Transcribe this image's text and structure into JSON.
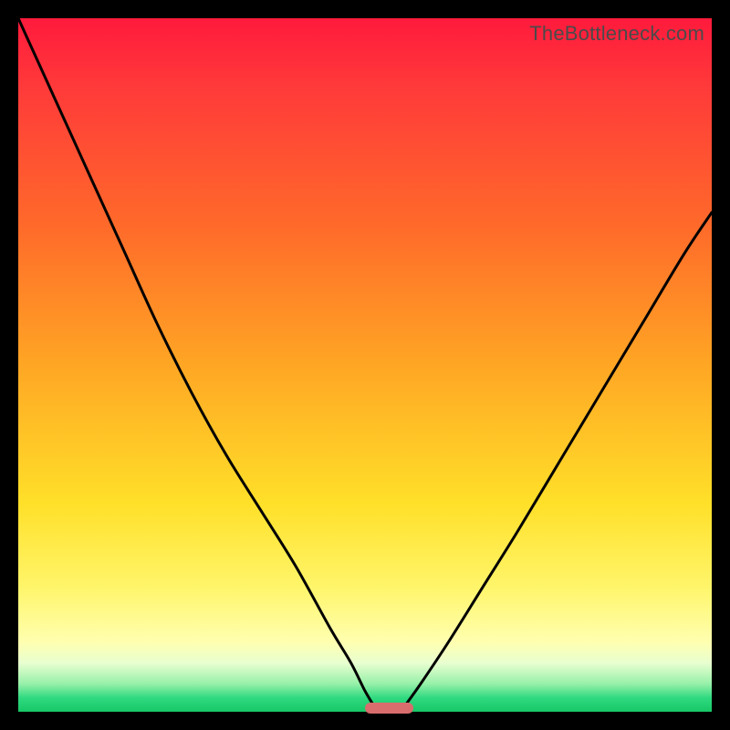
{
  "watermark": "TheBottleneck.com",
  "chart_data": {
    "type": "line",
    "title": "",
    "xlabel": "",
    "ylabel": "",
    "xlim": [
      0,
      100
    ],
    "ylim": [
      0,
      100
    ],
    "series": [
      {
        "name": "left-curve",
        "x": [
          0,
          5,
          10,
          15,
          20,
          25,
          30,
          35,
          40,
          45,
          48,
          50,
          51.5
        ],
        "values": [
          100,
          89,
          78,
          67,
          56,
          46,
          37,
          29,
          21,
          12,
          7,
          3,
          0.5
        ]
      },
      {
        "name": "right-curve",
        "x": [
          55.5,
          58,
          62,
          67,
          72,
          78,
          84,
          90,
          96,
          100
        ],
        "values": [
          0.5,
          4,
          10,
          18,
          26,
          36,
          46,
          56,
          66,
          72
        ]
      }
    ],
    "minimum_marker": {
      "x_start": 50,
      "x_end": 57,
      "y": 0,
      "color": "#d96d6d"
    },
    "background_gradient": {
      "top": "#ff1a3c",
      "mid": "#ffe029",
      "bottom": "#17c766"
    }
  }
}
